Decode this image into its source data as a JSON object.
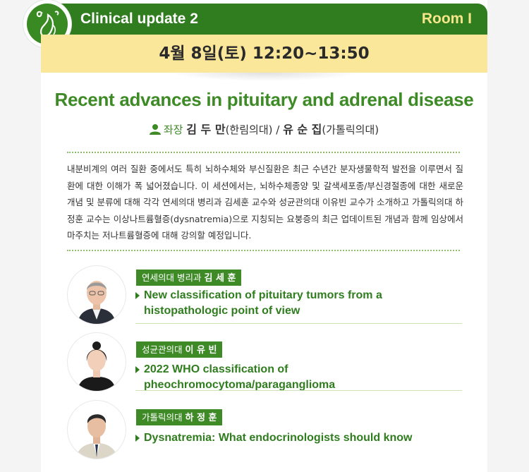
{
  "header": {
    "title": "Clinical update 2",
    "room": "Room I"
  },
  "date": "4월 8일(토) 12:20~13:50",
  "session": {
    "title": "Recent advances in pituitary and adrenal disease",
    "chair_label": "좌장",
    "chair1_name": "김 두 만",
    "chair1_affil": "(한림의대)",
    "separator": " / ",
    "chair2_name": "유 순 집",
    "chair2_affil": "(가톨릭의대)"
  },
  "description": "내분비계의 여러 질환 중에서도 특히 뇌하수체와 부신질환은 최근 수년간 분자생물학적 발전을 이루면서 질환에 대한 이해가 폭 넓어졌습니다. 이 세션에서는, 뇌하수체종양 및 갈색세포종/부신경절종에 대한 새로운 개념 및 분류에 대해 각각 연세의대 병리과 김세훈 교수와 성균관의대 이유빈 교수가 소개하고 가톨릭의대 하정훈 교수는 이상나트륨혈증(dysnatremia)으로 지칭되는 요붕증의 최근 업데이트된 개념과 함께 임상에서 마주치는 저나트륨혈증에 대해 강의할 예정입니다.",
  "talks": [
    {
      "affiliation": "연세의대 병리과",
      "speaker": "김 세 훈",
      "title": "New classification of pituitary tumors from a histopathologic point of view"
    },
    {
      "affiliation": "성균관의대",
      "speaker": "이 유 빈",
      "title": "2022 WHO classification of pheochromocytoma/paraganglioma"
    },
    {
      "affiliation": "가톨릭의대",
      "speaker": "하 정 훈",
      "title": "Dysnatremia: What endocrinologists should know"
    }
  ],
  "colors": {
    "green": "#3d8a26",
    "dark_green": "#2f7d1e",
    "yellow": "#fbe79a",
    "room_text": "#f7e58b"
  }
}
